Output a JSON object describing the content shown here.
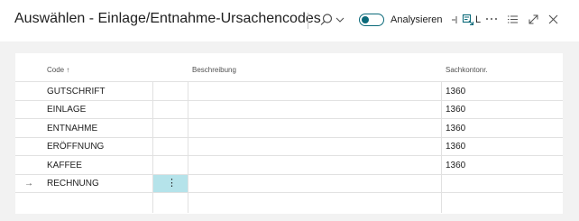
{
  "header": {
    "title": "Auswählen - Einlage/Entnahme-Ursachencodes",
    "analyze_label": "Analysieren",
    "filter_label": "L",
    "icons": [
      "search-icon",
      "chevron-down-icon",
      "toggle-switch",
      "filter-icon",
      "more-options-icon",
      "list-view-icon",
      "expand-icon",
      "close-icon"
    ]
  },
  "table": {
    "columns": {
      "code": "Code ↑",
      "description": "Beschreibung",
      "account": "Sachkontonr."
    },
    "rows": [
      {
        "code": "GUTSCHRIFT",
        "description": "",
        "account": "1360"
      },
      {
        "code": "EINLAGE",
        "description": "",
        "account": "1360"
      },
      {
        "code": "ENTNAHME",
        "description": "",
        "account": "1360"
      },
      {
        "code": "ERÖFFNUNG",
        "description": "",
        "account": "1360"
      },
      {
        "code": "KAFFEE",
        "description": "",
        "account": "1360"
      },
      {
        "code": "RECHNUNG",
        "description": "",
        "account": ""
      }
    ],
    "current_row_marker": "→",
    "row_actions_glyph": "⋮"
  },
  "colors": {
    "accent": "#0b6a7a",
    "selected_cell": "#b5e3ea",
    "background": "#f2f2f2"
  }
}
